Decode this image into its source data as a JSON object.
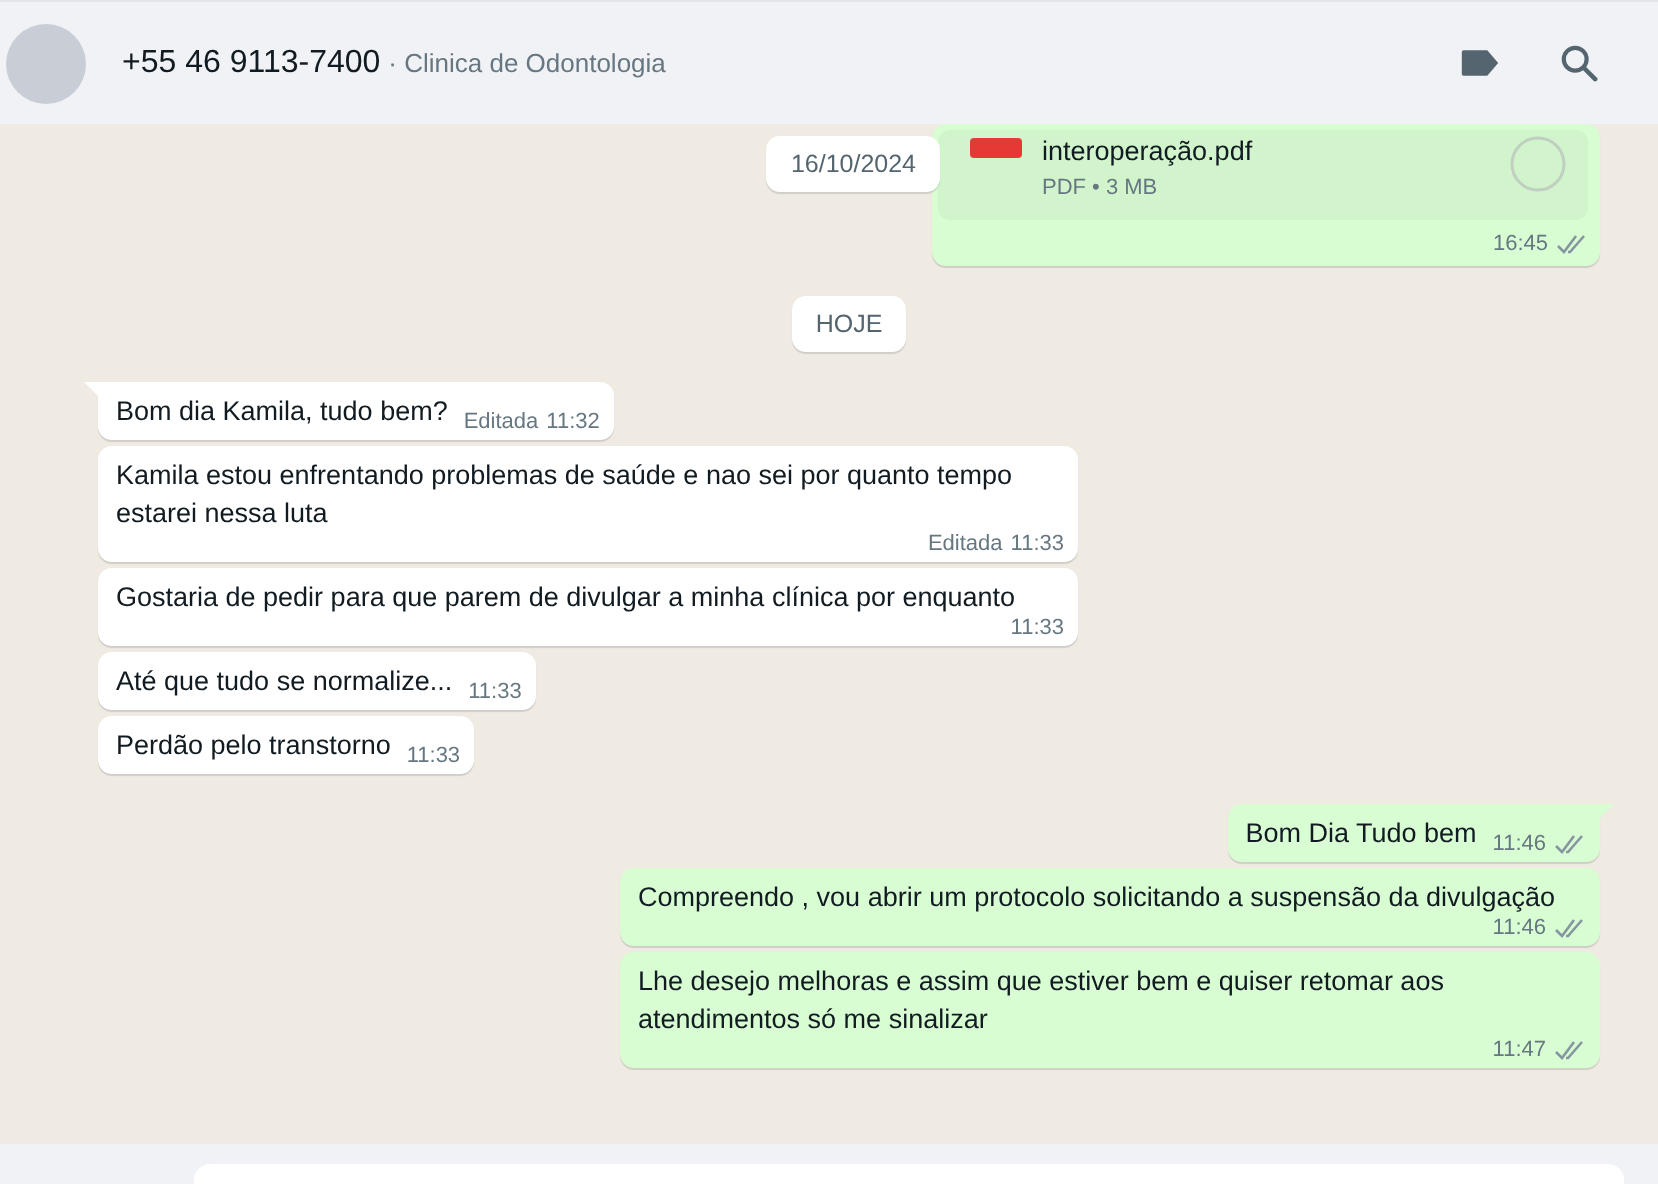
{
  "header": {
    "phone": "+55 46 9113-7400",
    "subtitle": "· Clinica de Odontologia"
  },
  "chat": [
    {
      "kind": "document",
      "date": "16/10/2024",
      "file_name": "interoperação.pdf",
      "file_info": "PDF • 3 MB",
      "time": "16:45",
      "read": false
    },
    {
      "kind": "date",
      "text": "HOJE"
    },
    {
      "kind": "in",
      "text": "Bom dia Kamila, tudo bem?",
      "edited": "Editada",
      "time": "11:32",
      "tail": true
    },
    {
      "kind": "in",
      "text": "Kamila estou enfrentando problemas de saúde e nao sei por quanto tempo estarei nessa luta",
      "edited": "Editada",
      "time": "11:33",
      "tail": false
    },
    {
      "kind": "in",
      "text": "Gostaria de pedir para que parem de divulgar a minha clínica por enquanto",
      "time": "11:33",
      "tail": false
    },
    {
      "kind": "in",
      "text": "Até que tudo se normalize...",
      "time": "11:33",
      "tail": false
    },
    {
      "kind": "in",
      "text": "Perdão pelo transtorno",
      "time": "11:33",
      "tail": false
    },
    {
      "kind": "out",
      "text": "Bom Dia Tudo bem",
      "time": "11:46",
      "read": false,
      "tail": true
    },
    {
      "kind": "out",
      "text": "Compreendo , vou abrir um protocolo solicitando a suspensão da divulgação",
      "time": "11:46",
      "read": false,
      "tail": false
    },
    {
      "kind": "out",
      "text": "Lhe desejo melhoras e assim que estiver bem e quiser retomar aos atendimentos só me sinalizar",
      "time": "11:47",
      "read": false,
      "tail": false
    }
  ]
}
